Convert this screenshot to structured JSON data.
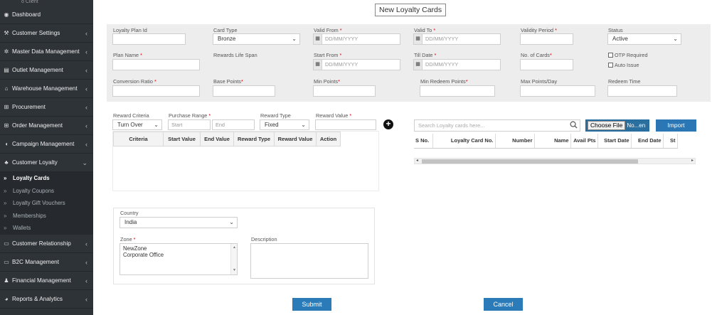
{
  "sidebar": {
    "top_text": "o Client",
    "items": [
      {
        "label": "Dashboard",
        "icon": "dashboard-icon",
        "glyph": "◉",
        "chevron": ""
      },
      {
        "label": "Customer Settings",
        "icon": "wrench-icon",
        "glyph": "⚒",
        "chevron": "‹"
      },
      {
        "label": "Master Data Management",
        "icon": "gear-icon",
        "glyph": "✲",
        "chevron": "‹"
      },
      {
        "label": "Outlet Management",
        "icon": "outlet-icon",
        "glyph": "▤",
        "chevron": "‹"
      },
      {
        "label": "Warehouse Management",
        "icon": "home-icon",
        "glyph": "⌂",
        "chevron": "‹"
      },
      {
        "label": "Procurement",
        "icon": "cart-icon",
        "glyph": "⊞",
        "chevron": "‹"
      },
      {
        "label": "Order Management",
        "icon": "order-icon",
        "glyph": "⊞",
        "chevron": "‹"
      },
      {
        "label": "Campaign Management",
        "icon": "campaign-icon",
        "glyph": "◖",
        "chevron": "‹"
      },
      {
        "label": "Customer Loyalty",
        "icon": "users-icon",
        "glyph": "♣",
        "chevron": "⌄"
      }
    ],
    "sub_items": [
      {
        "label": "Loyalty Cards",
        "active": true
      },
      {
        "label": "Loyalty Coupons",
        "active": false
      },
      {
        "label": "Loyalty Gift Vouchers",
        "active": false
      },
      {
        "label": "Memberships",
        "active": false
      },
      {
        "label": "Wallets",
        "active": false
      }
    ],
    "items_after": [
      {
        "label": "Customer Relationship",
        "icon": "relationship-icon",
        "glyph": "▭",
        "chevron": "‹"
      },
      {
        "label": "B2C Management",
        "icon": "b2c-icon",
        "glyph": "▭",
        "chevron": "‹"
      },
      {
        "label": "Financial Management",
        "icon": "finance-icon",
        "glyph": "♟",
        "chevron": "‹"
      },
      {
        "label": "Reports & Analytics",
        "icon": "reports-icon",
        "glyph": "◕",
        "chevron": "‹"
      }
    ]
  },
  "page": {
    "title": "New Loyalty Cards"
  },
  "form": {
    "loyalty_plan_id": {
      "label": "Loyalty Plan Id",
      "value": ""
    },
    "card_type": {
      "label": "Card Type",
      "value": "Bronze"
    },
    "valid_from": {
      "label": "Valid From",
      "required": "*",
      "placeholder": "DD/MM/YYYY"
    },
    "valid_to": {
      "label": "Valid To",
      "required": "*",
      "placeholder": "DD/MM/YYYY"
    },
    "validity_period": {
      "label": "Validity Period",
      "required": "*",
      "value": ""
    },
    "status": {
      "label": "Status",
      "value": "Active"
    },
    "plan_name": {
      "label": "Plan Name",
      "required": "*",
      "value": ""
    },
    "rewards_life_span": {
      "label": "Rewards Life Span"
    },
    "start_from": {
      "label": "Start From",
      "required": "*",
      "placeholder": "DD/MM/YYYY"
    },
    "till_date": {
      "label": "Till Date",
      "required": "*",
      "placeholder": "DD/MM/YYYY"
    },
    "no_of_cards": {
      "label": "No. of Cards",
      "required": "*",
      "value": ""
    },
    "otp_required": {
      "label": "OTP Required",
      "checked": false
    },
    "auto_issue": {
      "label": "Auto Issue",
      "checked": false
    },
    "conversion_ratio": {
      "label": "Conversion Ratio",
      "required": "*",
      "value": ""
    },
    "base_points": {
      "label": "Base Points",
      "required": "*",
      "value": ""
    },
    "min_points": {
      "label": "Min Points",
      "required": "*",
      "value": ""
    },
    "min_redeem_points": {
      "label": "Min Redeem Points",
      "required": "*",
      "value": ""
    },
    "max_points_day": {
      "label": "Max Points/Day",
      "value": ""
    },
    "redeem_time": {
      "label": "Redeem Time",
      "value": ""
    }
  },
  "reward": {
    "criteria_label": "Reward Criteria",
    "criteria_value": "Turn Over",
    "purchase_range_label": "Purchase Range",
    "purchase_range_req": "*",
    "start_placeholder": "Start",
    "end_placeholder": "End",
    "type_label": "Reward Type",
    "type_value": "Fixed",
    "value_label": "Reward Value",
    "value_req": "*",
    "add_symbol": "+",
    "table_headers": [
      "Criteria",
      "Start Value",
      "End Value",
      "Reward Type",
      "Reward Value",
      "Action"
    ]
  },
  "cards": {
    "search_placeholder": "Search Loyalty cards here...",
    "choose_file_label": "Choose File",
    "file_name_text": "No...en",
    "import_label": "Import",
    "table_headers": [
      "S No.",
      "Loyalty Card No.",
      "Number",
      "Name",
      "Avail Pts",
      "Start Date",
      "End Date",
      "St"
    ]
  },
  "location": {
    "country_label": "Country",
    "country_value": "India",
    "zone_label": "Zone",
    "zone_req": "*",
    "zones": [
      "NewZone",
      "Corporate Office"
    ],
    "description_label": "Description"
  },
  "actions": {
    "submit_label": "Submit",
    "cancel_label": "Cancel"
  },
  "colors": {
    "sidebar_bg": "#2e3338",
    "primary_button": "#2b7bb9",
    "form_panel_bg": "#ededed",
    "required": "#d00000"
  }
}
